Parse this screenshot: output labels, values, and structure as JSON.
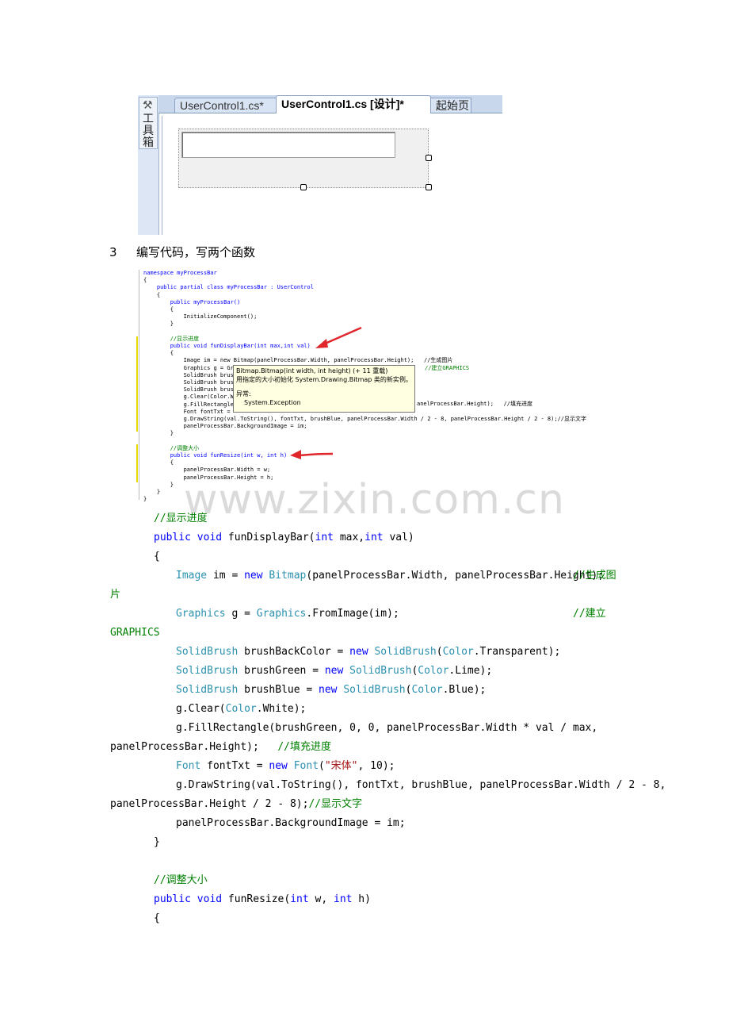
{
  "designer": {
    "toolbox_label": "工具箱",
    "tabs": [
      "UserControl1.cs*",
      "UserControl1.cs [设计]*",
      "起始页"
    ]
  },
  "step": {
    "number": "3",
    "text": "编写代码，写两个函数"
  },
  "screenshot_code": [
    "namespace myProcessBar",
    "{",
    "    public partial class myProcessBar : UserControl",
    "    {",
    "        public myProcessBar()",
    "        {",
    "            InitializeComponent();",
    "        }",
    "",
    "        //显示进度",
    "        public void funDisplayBar(int max,int val)",
    "        {",
    "            Image im = new Bitmap(panelProcessBar.Width, panelProcessBar.Height);   //生成图片",
    "            Graphics g = Gr",
    "            SolidBrush brus",
    "            SolidBrush brus",
    "            SolidBrush brus",
    "            g.Clear(Color.W",
    "            g.FillRectangle",
    "            Font fontTxt =",
    "            g.DrawString(val.ToString(), fontTxt, brushBlue, panelProcessBar.Width / 2 - 8, panelProcessBar.Height / 2 - 8);//显示文字",
    "            panelProcessBar.BackgroundImage = im;",
    "        }",
    "",
    "        //调整大小",
    "        public void funResize(int w, int h)",
    "        {",
    "            panelProcessBar.Width = w;",
    "            panelProcessBar.Height = h;",
    "        }",
    "    }",
    "}"
  ],
  "screenshot_side_comments": {
    "graphics": "//建立GRAPHICS",
    "fill_tail": "anelProcessBar.Height);   //填充进度"
  },
  "tooltip": {
    "signature": "Bitmap.Bitmap(int width, int height)  (+ 11 重载)",
    "description": "用指定的大小初始化 System.Drawing.Bitmap 类的新实例。",
    "exceptions_label": "异常:",
    "exception": "System.Exception"
  },
  "watermark": "www.zixin.com.cn",
  "code": {
    "c_display": "//显示进度",
    "kw_public": "public",
    "kw_void": "void",
    "kw_int": "int",
    "kw_new": "new",
    "fn_display_a": " funDisplayBar(",
    "fn_display_b": " max,",
    "fn_display_c": " val)",
    "brace_open": "{",
    "brace_close": "}",
    "ty_image": "Image",
    "l1_mid": " im = ",
    "ty_bitmap": "Bitmap",
    "l1_tail": "(panelProcessBar.Width, panelProcessBar.Height);",
    "c_gen_img_1": "//生成图",
    "c_gen_img_2": "片",
    "ty_graphics": "Graphics",
    "l2_mid": " g = ",
    "l2_tail": ".FromImage(im);",
    "c_graphics_1": "//建立",
    "c_graphics_2": "GRAPHICS",
    "ty_solidbrush": "SolidBrush",
    "l3_mid": " brushBackColor = ",
    "ty_color": "Color",
    "l3_tail": ".Transparent);",
    "l4_mid": " brushGreen = ",
    "l4_tail": ".Lime);",
    "l5_mid": " brushBlue = ",
    "l5_tail": ".Blue);",
    "l6_head": "g.Clear(",
    "l6_tail": ".White);",
    "l7_a": "g.FillRectangle(brushGreen, 0, 0, panelProcessBar.Width * val / max,",
    "l7_b": "panelProcessBar.Height);",
    "c_fill": "//填充进度",
    "ty_font": "Font",
    "l8_mid": " fontTxt = ",
    "l8_open": "(",
    "st_font": "\"宋体\"",
    "l8_tail": ", 10);",
    "l9_a": "g.DrawString(val.ToString(), fontTxt, brushBlue, panelProcessBar.Width / 2 - 8,",
    "l9_b": "panelProcessBar.Height / 2 - 8);",
    "c_text": "//显示文字",
    "l10": "panelProcessBar.BackgroundImage = im;",
    "c_resize": "//调整大小",
    "fn_resize_a": " funResize(",
    "fn_resize_b": " w, ",
    "fn_resize_c": " h)"
  }
}
